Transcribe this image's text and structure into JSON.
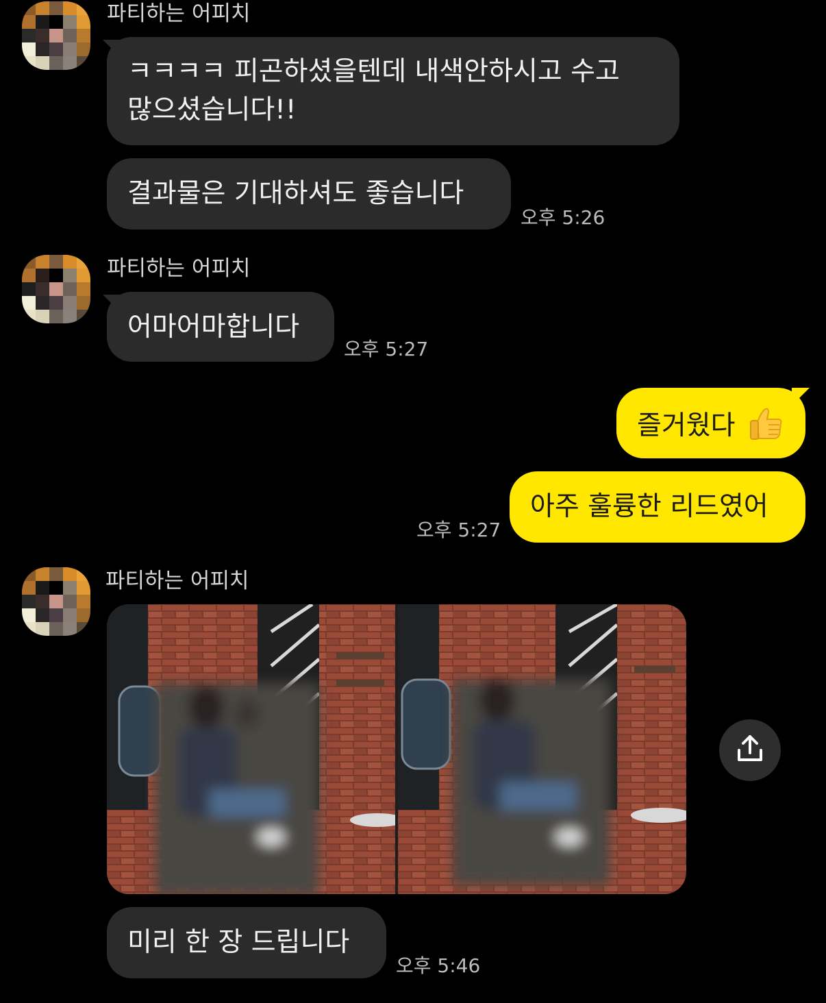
{
  "colors": {
    "background": "#000000",
    "incoming_bubble": "#2b2b2b",
    "outgoing_bubble": "#ffe700",
    "timestamp": "#bdbdbd",
    "sender_name": "#d6d6d6"
  },
  "groups": [
    {
      "sender": "파티하는 어피치",
      "messages": [
        {
          "line1": "ㅋㅋㅋㅋ 피곤하셨을텐데 내색안하시고 수고",
          "line2": "많으셨습니다!!"
        },
        {
          "text": "결과물은 기대하셔도 좋습니다"
        }
      ],
      "time": "오후 5:26"
    },
    {
      "sender": "파티하는 어피치",
      "messages": [
        {
          "text": "어마어마합니다"
        }
      ],
      "time": "오후 5:27"
    },
    {
      "sender": "파티하는 어피치",
      "messages": [
        {
          "text": "미리 한 장 드립니다"
        }
      ],
      "time": "오후 5:46",
      "attachment": {
        "type": "photos",
        "count": 2,
        "share_icon": "share-icon"
      }
    }
  ],
  "outgoing": {
    "messages": [
      {
        "text": "즐거웠다",
        "emoji": "thumbs-up-icon"
      },
      {
        "text": "아주 훌륭한 리드였어"
      }
    ],
    "time": "오후 5:27"
  }
}
